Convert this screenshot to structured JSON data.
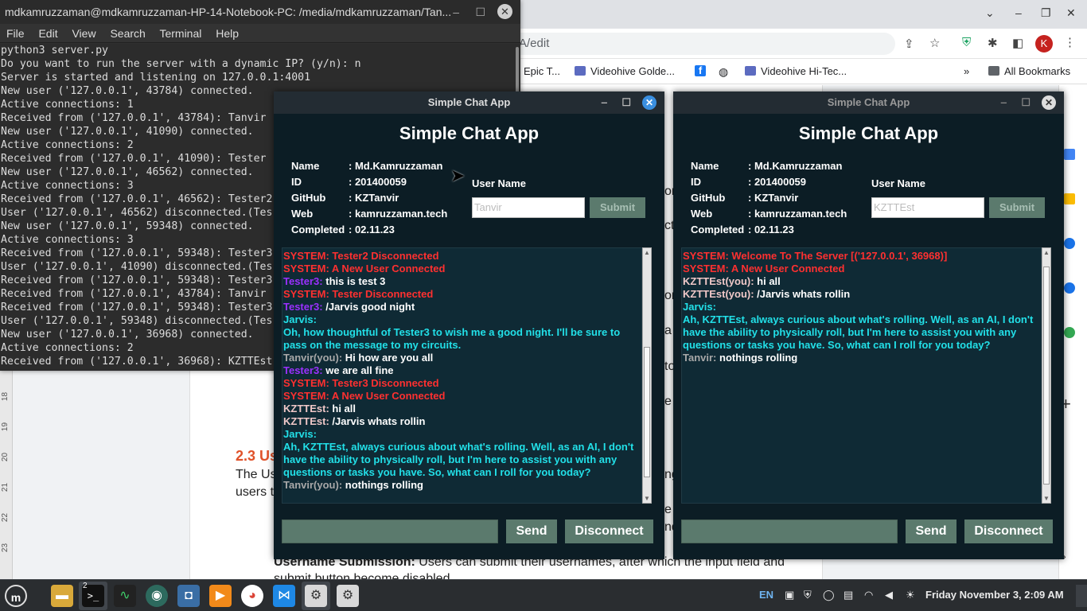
{
  "browser": {
    "url_fragment": "A/edit",
    "bookmarks": [
      "Epic T...",
      "Videohive Golde...",
      "Videohive Hi-Tec...",
      "All Bookmarks"
    ],
    "profile_letter": "K"
  },
  "doc": {
    "heading": "2.3 Us",
    "line1": "The Us",
    "line2": "users t",
    "bold_label": "Username Submission:",
    "bold_rest": " Users can submit their usernames, after which the input field and",
    "cut_line": "submit button become disabled",
    "ruler_numbers": [
      "18",
      "19",
      "20",
      "21",
      "22",
      "23"
    ],
    "right_frag": [
      "on",
      "ct",
      "on",
      "a",
      "to",
      "e",
      "ng",
      "e",
      "nd"
    ]
  },
  "terminal": {
    "title": "mdkamruzzaman@mdkamruzzaman-HP-14-Notebook-PC: /media/mdkamruzzaman/Tan...",
    "menu": [
      "File",
      "Edit",
      "View",
      "Search",
      "Terminal",
      "Help"
    ],
    "output": "python3 server.py\nDo you want to run the server with a dynamic IP? (y/n): n\nServer is started and listening on 127.0.0.1:4001\nNew user ('127.0.0.1', 43784) connected.\nActive connections: 1\nReceived from ('127.0.0.1', 43784): Tanvir\nNew user ('127.0.0.1', 41090) connected.\nActive connections: 2\nReceived from ('127.0.0.1', 41090): Tester\nNew user ('127.0.0.1', 46562) connected.\nActive connections: 3\nReceived from ('127.0.0.1', 46562): Tester2\nUser ('127.0.0.1', 46562) disconnected.(Tes\nNew user ('127.0.0.1', 59348) connected.\nActive connections: 3\nReceived from ('127.0.0.1', 59348): Tester3\nUser ('127.0.0.1', 41090) disconnected.(Tes\nReceived from ('127.0.0.1', 59348): Tester3\nReceived from ('127.0.0.1', 43784): Tanvir\nReceived from ('127.0.0.1', 59348): Tester3\nUser ('127.0.0.1', 59348) disconnected.(Tes\nNew user ('127.0.0.1', 36968) connected.\nActive connections: 2\nReceived from ('127.0.0.1', 36968): KZTTEst"
  },
  "chat_common": {
    "window_title": "Simple Chat App",
    "app_title": "Simple Chat App",
    "info": [
      {
        "k": "Name",
        "v": ": Md.Kamruzzaman"
      },
      {
        "k": "ID",
        "v": ": 201400059"
      },
      {
        "k": "GitHub",
        "v": ": KZTanvir"
      },
      {
        "k": "Web",
        "v": ": kamruzzaman.tech"
      },
      {
        "k": "Completed",
        "v": ": 02.11.23"
      }
    ],
    "user_label": "User Name",
    "submit_label": "Submit",
    "send_label": "Send",
    "disconnect_label": "Disconnect"
  },
  "chat1": {
    "username_value": "Tanvir",
    "scroll_thumb_start": 0.38,
    "scroll_thumb_end": 0.93,
    "messages": [
      {
        "who": "SYSTEM: Tester2 Disconnected",
        "whoClass": "sys",
        "text": ""
      },
      {
        "who": "SYSTEM: A New User Connected",
        "whoClass": "sys",
        "text": ""
      },
      {
        "who": "Tester3: ",
        "whoClass": "oth",
        "text": "this is test 3"
      },
      {
        "who": "SYSTEM: Tester Disconnected",
        "whoClass": "sys",
        "text": ""
      },
      {
        "who": "Tester3: ",
        "whoClass": "oth",
        "text": "/Jarvis good night"
      },
      {
        "who": "Jarvis:",
        "whoClass": "jar",
        "text": ""
      },
      {
        "who": "",
        "whoClass": "jar",
        "text": "Oh, how thoughtful of Tester3 to wish me a good night. I'll be sure to pass on the message to my circuits.",
        "textClass": "jar"
      },
      {
        "who": "Tanvir(you): ",
        "whoClass": "you",
        "text": "Hi how are you all"
      },
      {
        "who": "Tester3: ",
        "whoClass": "oth",
        "text": "we are all fine"
      },
      {
        "who": "SYSTEM: Tester3 Disconnected",
        "whoClass": "sys",
        "text": ""
      },
      {
        "who": "SYSTEM: A New User Connected",
        "whoClass": "sys",
        "text": ""
      },
      {
        "who": "KZTTEst: ",
        "whoClass": "usr",
        "text": "hi all"
      },
      {
        "who": "KZTTEst: ",
        "whoClass": "usr",
        "text": "/Jarvis whats rollin"
      },
      {
        "who": "Jarvis:",
        "whoClass": "jar",
        "text": ""
      },
      {
        "who": "",
        "whoClass": "jar",
        "text": "Ah, KZTTEst, always curious about what's rolling. Well, as an AI, I don't have the ability to physically roll, but I'm here to assist you with any questions or tasks you have. So, what can I roll for you today?",
        "textClass": "jar"
      },
      {
        "who": "Tanvir(you): ",
        "whoClass": "you",
        "text": "nothings rolling"
      }
    ]
  },
  "chat2": {
    "username_value": "KZTTEst",
    "scroll_thumb_start": 0.04,
    "scroll_thumb_end": 0.96,
    "messages": [
      {
        "who": "SYSTEM: Welcome To The Server [('127.0.0.1', 36968)]",
        "whoClass": "sys",
        "text": ""
      },
      {
        "who": "SYSTEM: A New User Connected",
        "whoClass": "sys",
        "text": ""
      },
      {
        "who": "KZTTEst(you): ",
        "whoClass": "usr",
        "text": "hi all"
      },
      {
        "who": "KZTTEst(you): ",
        "whoClass": "usr",
        "text": "/Jarvis whats rollin"
      },
      {
        "who": "Jarvis:",
        "whoClass": "jar",
        "text": ""
      },
      {
        "who": "",
        "whoClass": "jar",
        "text": "Ah, KZTTEst, always curious about what's rolling. Well, as an AI, I don't have the ability to physically roll, but I'm here to assist you with any questions or tasks you have. So, what can I roll for you today?",
        "textClass": "jar"
      },
      {
        "who": "Tanvir: ",
        "whoClass": "you",
        "text": "nothings rolling"
      }
    ]
  },
  "taskbar": {
    "terminal_badge": "2",
    "lang": "EN",
    "clock": "Friday November  3, 2:09 AM"
  }
}
